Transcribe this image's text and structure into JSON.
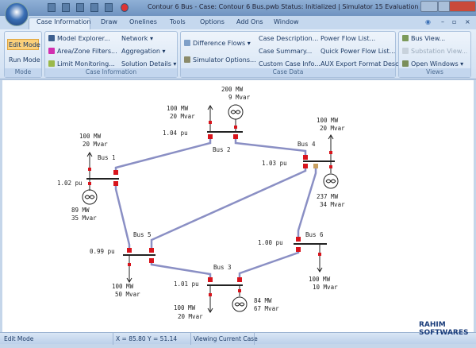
{
  "window": {
    "title": "Contour 6 Bus - Case: Contour 6 Bus.pwb  Status: Initialized | Simulator 15 Evaluation"
  },
  "tabs": [
    "Case Information",
    "Draw",
    "Onelines",
    "Tools",
    "Options",
    "Add Ons",
    "Window"
  ],
  "ribbon": {
    "mode": {
      "label": "Mode",
      "edit": "Edit Mode",
      "run": "Run Mode"
    },
    "case_information": {
      "label": "Case Information",
      "items": [
        "Model Explorer...",
        "Area/Zone Filters...",
        "Limit Monitoring..."
      ],
      "dropdowns": [
        "Network",
        "Aggregation",
        "Solution Details"
      ]
    },
    "case_data": {
      "label": "Case Data",
      "items": [
        "Difference Flows",
        "Simulator Options...",
        "Case Description...",
        "Case Summary...",
        "Custom Case Info...",
        "Power Flow List...",
        "Quick Power Flow List...",
        "AUX Export Format Desc..."
      ]
    },
    "views": {
      "label": "Views",
      "items": [
        "Bus View...",
        "Substation View...",
        "Open Windows"
      ]
    }
  },
  "oneline": {
    "buses": [
      {
        "name": "Bus 1",
        "voltage": "1.02 pu"
      },
      {
        "name": "Bus 2",
        "voltage": "1.04 pu"
      },
      {
        "name": "Bus 3",
        "voltage": "1.01 pu"
      },
      {
        "name": "Bus 4",
        "voltage": "1.03 pu"
      },
      {
        "name": "Bus 5",
        "voltage": "0.99 pu"
      },
      {
        "name": "Bus 6",
        "voltage": "1.00 pu"
      }
    ],
    "loads": [
      {
        "mw": "100 MW",
        "mvar": "20 Mvar"
      },
      {
        "mw": "100 MW",
        "mvar": "20 Mvar"
      },
      {
        "mw": "100 MW",
        "mvar": "20 Mvar"
      },
      {
        "mw": "100 MW",
        "mvar": "20 Mvar"
      },
      {
        "mw": "100 MW",
        "mvar": "50 Mvar"
      },
      {
        "mw": "100 MW",
        "mvar": "10 Mvar"
      }
    ],
    "generators": [
      {
        "mw": "89 MW",
        "mvar": "35 Mvar"
      },
      {
        "mw": "200 MW",
        "mvar": "9 Mvar"
      },
      {
        "mw": "84 MW",
        "mvar": "67 Mvar"
      },
      {
        "mw": "237 MW",
        "mvar": "34 Mvar"
      }
    ],
    "colors": {
      "line": "#8a8fc4",
      "breaker": "#d8141c",
      "bus": "#222222"
    }
  },
  "status": {
    "mode": "Edit Mode",
    "coords": "X = 85.80 Y = 51.14",
    "view": "Viewing Current Case"
  },
  "watermark": "RAHIM SOFTWARES"
}
